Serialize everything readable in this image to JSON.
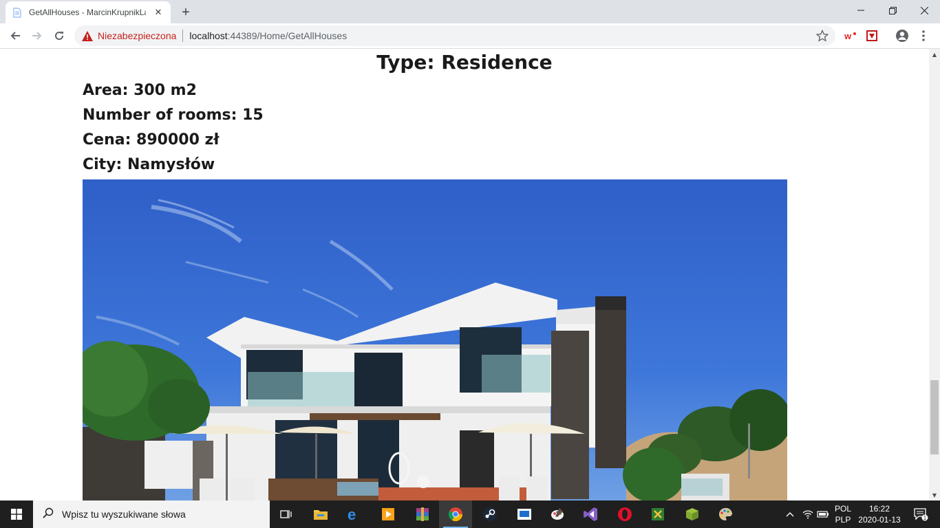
{
  "browser": {
    "tab_title": "GetAllHouses - MarcinKrupnikLab",
    "security_label": "Niezabezpieczona",
    "url_host": "localhost",
    "url_rest": ":44389/Home/GetAllHouses"
  },
  "house": {
    "type_line": "Type: Residence",
    "area_line": "Area: 300 m2",
    "rooms_line": "Number of rooms: 15",
    "price_line": "Cena: 890000 zł",
    "city_line": "City: Namysłów"
  },
  "taskbar": {
    "search_placeholder": "Wpisz tu wyszukiwane słowa",
    "lang_top": "POL",
    "lang_bottom": "PLP",
    "time": "16:22",
    "date": "2020-01-13",
    "notification_count": "1"
  },
  "colors": {
    "sky": "#3d6fd1",
    "insecure_red": "#c5221f",
    "taskbar": "#1f1f1f"
  },
  "icons": [
    "page-icon",
    "close-icon",
    "plus-icon",
    "minimize-icon",
    "restore-icon",
    "window-close-icon",
    "back-arrow-icon",
    "forward-arrow-icon",
    "reload-icon",
    "warning-icon",
    "star-icon",
    "wykop-icon",
    "mcafee-icon",
    "account-icon",
    "menu-dots-icon",
    "windows-start-icon",
    "search-icon",
    "task-view-icon",
    "file-explorer-icon",
    "edge-icon",
    "media-player-icon",
    "winrar-icon",
    "chrome-icon",
    "steam-icon",
    "app-icon",
    "paint-icon",
    "visual-studio-icon",
    "opera-icon",
    "excel-icon",
    "minecraft-icon",
    "paint-palette-icon",
    "chevron-up-icon",
    "wifi-icon",
    "battery-icon",
    "notification-icon"
  ]
}
